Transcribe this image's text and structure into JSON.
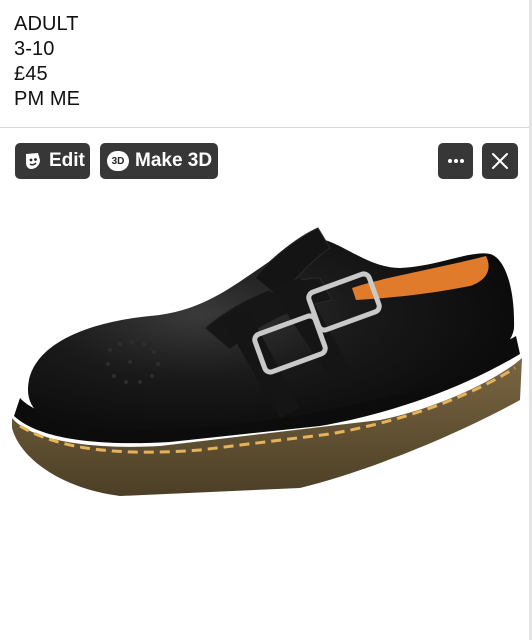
{
  "post": {
    "lines": [
      "ADULT",
      "3-10",
      "£45",
      "PM ME"
    ]
  },
  "toolbar": {
    "edit_label": "Edit",
    "make3d_label": "Make 3D",
    "make3d_icon_text": "3D"
  },
  "icons": {
    "edit": "face-edit-icon",
    "make3d": "3d-icon",
    "more": "more-dots-icon",
    "close": "close-icon"
  },
  "colors": {
    "button_bg": "#262626",
    "shoe_leather": "#101010",
    "sole": "#6b5a3a",
    "stitch": "#e6b25a",
    "lining": "#e07b2c"
  }
}
